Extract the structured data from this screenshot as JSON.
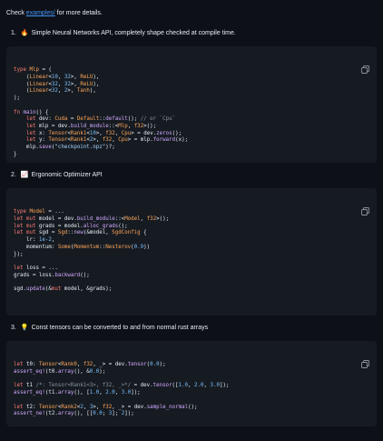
{
  "intro": {
    "prefix": "Check ",
    "link": "examples/",
    "suffix": " for more details."
  },
  "sections": [
    {
      "num": "1.",
      "emoji": "🔥",
      "title": "Simple Neural Networks API, completely shape checked at compile time."
    },
    {
      "num": "2.",
      "emoji": "📈",
      "title": "Ergonomic Optimizer API"
    },
    {
      "num": "3.",
      "emoji": "💡",
      "title": "Const tensors can be converted to and from normal rust arrays"
    }
  ],
  "code1": [
    "type Mlp = (",
    "    (Linear<10, 32>, ReLU),",
    "    (Linear<32, 32>, ReLU),",
    "    (Linear<32, 2>, Tanh),",
    ");",
    "",
    "fn main() {",
    "    let dev: Cuda = Default::default(); // or `Cpu`",
    "    let mlp = dev.build_module::<Mlp, f32>();",
    "    let x: Tensor<Rank1<10>, f32, Cpu> = dev.zeros();",
    "    let y: Tensor<Rank1<2>, f32, Cpu> = mlp.forward(x);",
    "    mlp.save(\"checkpoint.npz\")?;",
    "}"
  ],
  "code2": [
    "type Model = ...",
    "let mut model = dev.build_module::<Model, f32>();",
    "let mut grads = model.alloc_grads();",
    "let mut sgd = Sgd::new(&model, SgdConfig {",
    "    lr: 1e-2,",
    "    momentum: Some(Momentum::Nesterov(0.9))",
    "});",
    "",
    "let loss = ...",
    "grads = loss.backward();",
    "",
    "sgd.update(&mut model, &grads);"
  ],
  "code3": [
    "let t0: Tensor<Rank0, f32, _> = dev.tensor(0.0);",
    "assert_eq!(t0.array(), &0.0);",
    "",
    "let t1 /*: Tensor<Rank1<3>, f32, _>*/ = dev.tensor([1.0, 2.0, 3.0]);",
    "assert_eq!(t1.array(), [1.0, 2.0, 3.0]);",
    "",
    "let t2: Tensor<Rank2<2, 3>, f32, _> = dev.sample_normal();",
    "assert_ne!(t2.array(), [[0.0; 3]; 2]);"
  ]
}
